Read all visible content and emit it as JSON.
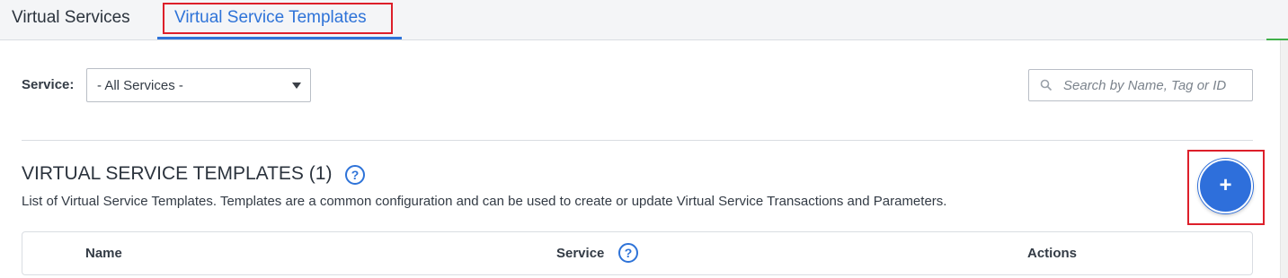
{
  "tabs": [
    {
      "label": "Virtual Services",
      "active": false
    },
    {
      "label": "Virtual Service Templates",
      "active": true
    }
  ],
  "filter": {
    "service_label": "Service:",
    "service_value": "- All Services -",
    "search_placeholder": "Search by Name, Tag or ID"
  },
  "section": {
    "title": "VIRTUAL SERVICE TEMPLATES (1)",
    "description": "List of Virtual Service Templates. Templates are a common configuration and can be used to create or update Virtual Service Transactions and Parameters.",
    "add_label": "+",
    "help_glyph": "?"
  },
  "table": {
    "columns": [
      "Name",
      "Service",
      "Actions"
    ]
  },
  "colors": {
    "accent": "#2e73d8",
    "highlight_border": "#dd1f2a"
  },
  "icons": [
    "caret-down-icon",
    "search-icon",
    "help-icon",
    "plus-icon"
  ]
}
